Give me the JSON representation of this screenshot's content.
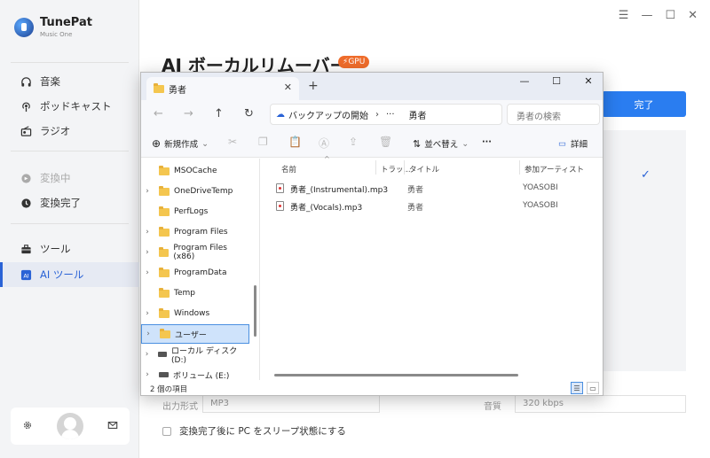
{
  "app": {
    "name": "TunePat",
    "subtitle": "Music One",
    "title": "AI ボーカルリムーバー",
    "gpu_badge": "GPU",
    "done_label": "完了",
    "nav": {
      "music": "音楽",
      "podcast": "ポッドキャスト",
      "radio": "ラジオ",
      "converting": "変換中",
      "converted": "変換完了",
      "tools": "ツール",
      "ai_tools": "AI ツール"
    },
    "form": {
      "format_label": "出力形式",
      "format_value": "MP3",
      "quality_label": "音質",
      "quality_value": "320 kbps",
      "sleep_label": "変換完了後に PC をスリープ状態にする"
    }
  },
  "explorer": {
    "tab_title": "勇者",
    "address": {
      "root": "バックアップの開始",
      "more": "···",
      "current": "勇者"
    },
    "search_placeholder": "勇者の検索",
    "commands": {
      "new": "新規作成",
      "sort": "並べ替え",
      "more": "···",
      "details": "詳細"
    },
    "tree": [
      {
        "label": "MSOCache",
        "type": "folder",
        "expandable": false
      },
      {
        "label": "OneDriveTemp",
        "type": "folder",
        "expandable": true
      },
      {
        "label": "PerfLogs",
        "type": "folder",
        "expandable": false
      },
      {
        "label": "Program Files",
        "type": "folder",
        "expandable": true
      },
      {
        "label": "Program Files (x86)",
        "type": "folder",
        "expandable": true
      },
      {
        "label": "ProgramData",
        "type": "folder",
        "expandable": true
      },
      {
        "label": "Temp",
        "type": "folder",
        "expandable": false
      },
      {
        "label": "Windows",
        "type": "folder",
        "expandable": true
      },
      {
        "label": "ユーザー",
        "type": "folder",
        "expandable": true,
        "selected": true
      },
      {
        "label": "ローカル ディスク (D:)",
        "type": "drive",
        "expandable": true
      },
      {
        "label": "ボリューム (E:)",
        "type": "drive",
        "expandable": true
      }
    ],
    "columns": {
      "name": "名前",
      "track": "トラッ...",
      "title": "タイトル",
      "artist": "参加アーティスト"
    },
    "files": [
      {
        "name": "勇者_(Instrumental).mp3",
        "title": "勇者",
        "artist": "YOASOBI"
      },
      {
        "name": "勇者_(Vocals).mp3",
        "title": "勇者",
        "artist": "YOASOBI"
      }
    ],
    "status": "2 個の項目"
  }
}
